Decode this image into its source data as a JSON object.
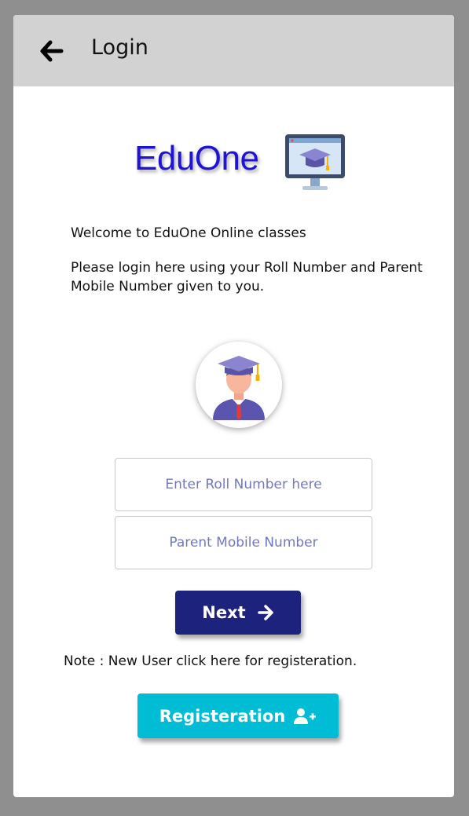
{
  "header": {
    "title": "Login",
    "back_icon": "arrow-left-icon"
  },
  "logo": {
    "text": "EduOne",
    "icon": "monitor-graduation-cap-icon"
  },
  "content": {
    "welcome": "Welcome to EduOne Online classes",
    "instructions": "Please login here using your Roll Number and Parent Mobile Number given to you."
  },
  "avatar": {
    "icon": "graduate-student-icon"
  },
  "form": {
    "roll_placeholder": "Enter Roll Number here",
    "mobile_placeholder": "Parent Mobile Number",
    "next_label": "Next",
    "next_icon": "arrow-right-icon"
  },
  "registration": {
    "note": "Note : New User click here for registeration.",
    "button_label": "Registeration",
    "button_icon": "user-plus-icon"
  },
  "colors": {
    "background": "#8f8f8f",
    "header": "#d2d2d2",
    "logo_text": "#1f14d6",
    "next_button": "#1d237d",
    "registration_button": "#00bcd4",
    "placeholder": "#7277c4"
  }
}
